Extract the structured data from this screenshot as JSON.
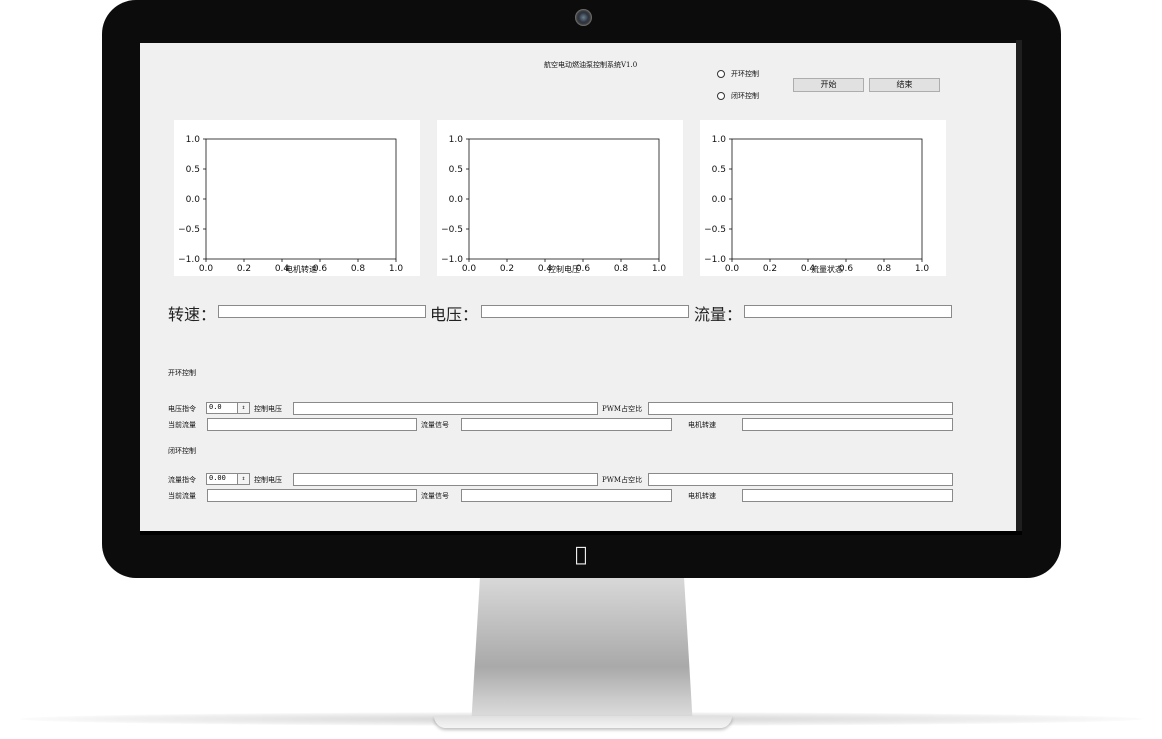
{
  "app": {
    "title": "航空电动燃油泵控制系统V1.0"
  },
  "mode": {
    "open_loop_label": "开环控制",
    "closed_loop_label": "闭环控制"
  },
  "toolbar": {
    "start_label": "开始",
    "end_label": "结束"
  },
  "plots": [
    {
      "xlabel": "电机转速"
    },
    {
      "xlabel": "控制电压"
    },
    {
      "xlabel": "流量状态"
    }
  ],
  "chart_data": [
    {
      "type": "line",
      "series": [],
      "xlabel": "电机转速",
      "xlim": [
        0.0,
        1.0
      ],
      "ylim": [
        -1.0,
        1.0
      ],
      "xticks": [
        "0.0",
        "0.2",
        "0.4",
        "0.6",
        "0.8",
        "1.0"
      ],
      "yticks": [
        "1.0",
        "0.5",
        "0.0",
        "−0.5",
        "−1.0"
      ]
    },
    {
      "type": "line",
      "series": [],
      "xlabel": "控制电压",
      "xlim": [
        0.0,
        1.0
      ],
      "ylim": [
        -1.0,
        1.0
      ],
      "xticks": [
        "0.0",
        "0.2",
        "0.4",
        "0.6",
        "0.8",
        "1.0"
      ],
      "yticks": [
        "1.0",
        "0.5",
        "0.0",
        "−0.5",
        "−1.0"
      ]
    },
    {
      "type": "line",
      "series": [],
      "xlabel": "流量状态",
      "xlim": [
        0.0,
        1.0
      ],
      "ylim": [
        -1.0,
        1.0
      ],
      "xticks": [
        "0.0",
        "0.2",
        "0.4",
        "0.6",
        "0.8",
        "1.0"
      ],
      "yticks": [
        "1.0",
        "0.5",
        "0.0",
        "−0.5",
        "−1.0"
      ]
    }
  ],
  "readouts": {
    "speed_label": "转速：",
    "voltage_label": "电压：",
    "flow_label": "流量："
  },
  "open_loop": {
    "section_title": "开环控制",
    "cmd_label": "电压指令",
    "cmd_value": "0.0",
    "ctrl_voltage_label": "控制电压",
    "pwm_label": "PWM占空比",
    "current_flow_label": "当前流量",
    "flow_signal_label": "流量信号",
    "motor_speed_label": "电机转速"
  },
  "closed_loop": {
    "section_title": "闭环控制",
    "cmd_label": "流量指令",
    "cmd_value": "0.00",
    "ctrl_voltage_label": "控制电压",
    "pwm_label": "PWM占空比",
    "current_flow_label": "当前流量",
    "flow_signal_label": "流量信号",
    "motor_speed_label": "电机转速"
  },
  "device": {
    "logo_icon": "apple-logo-icon",
    "camera_icon": "camera-icon"
  }
}
